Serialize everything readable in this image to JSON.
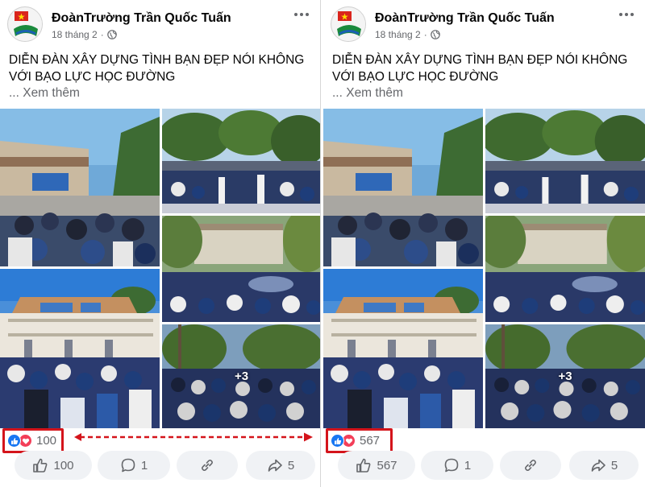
{
  "posts": [
    {
      "page_name": "ĐoànTrường Trần Quốc Tuấn",
      "date": "18 tháng 2",
      "separator": "·",
      "text": "DIỄN ĐÀN XÂY DỰNG TÌNH BẠN ĐẸP NÓI KHÔNG VỚI BẠO LỰC HỌC ĐƯỜNG",
      "see_more": "... Xem thêm",
      "extra_photos": "+3",
      "reaction_count": "100",
      "actions": {
        "like": "100",
        "comment": "1",
        "share": "5"
      }
    },
    {
      "page_name": "ĐoànTrường Trần Quốc Tuấn",
      "date": "18 tháng 2",
      "separator": "·",
      "text": "DIỄN ĐÀN XÂY DỰNG TÌNH BẠN ĐẸP NÓI KHÔNG VỚI BẠO LỰC HỌC ĐƯỜNG",
      "see_more": "... Xem thêm",
      "extra_photos": "+3",
      "reaction_count": "567",
      "actions": {
        "like": "567",
        "comment": "1",
        "share": "5"
      }
    }
  ],
  "icons": {
    "avatar": "youth-union-logo-icon",
    "privacy": "globe-icon",
    "menu": "more-dots-icon",
    "reactions": [
      "like-reaction-icon",
      "love-reaction-icon"
    ],
    "actions": [
      "thumbs-up-icon",
      "comment-icon",
      "link-icon",
      "share-icon"
    ]
  },
  "colors": {
    "highlight_box": "#d4141b",
    "like_blue": "#1877f2",
    "love_red": "#f33e58",
    "secondary_text": "#65676b",
    "button_bg": "#f0f2f5"
  }
}
